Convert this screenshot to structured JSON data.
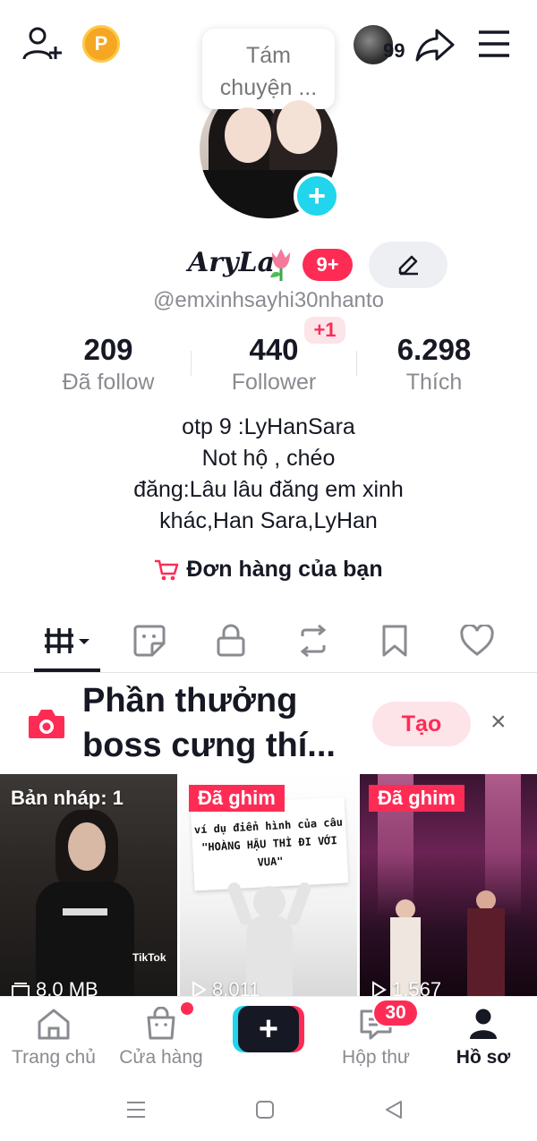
{
  "header": {
    "bubble_text": "Tám chuyện ...",
    "story_count": "99"
  },
  "profile": {
    "name": "AryLa",
    "level_badge": "9+",
    "handle": "@emxinhsayhi30nhanto"
  },
  "stats": [
    {
      "value": "209",
      "label": "Đã follow"
    },
    {
      "value": "440",
      "label": "Follower",
      "badge": "+1"
    },
    {
      "value": "6.298",
      "label": "Thích"
    }
  ],
  "bio": [
    "otp 9 :LyHanSara",
    "Not hộ , chéo",
    "đăng:Lâu lâu đăng em xinh",
    "khác,Han Sara,LyHan"
  ],
  "orders_label": "Đơn hàng của bạn",
  "reward": {
    "title": "Phần thưởng boss cưng thí...",
    "create_label": "Tạo",
    "close_label": "×"
  },
  "videos": [
    {
      "tag": "Bản nháp: 1",
      "meta": "8,0 MB",
      "watermark": "TikTok"
    },
    {
      "tag": "Đã ghim",
      "meta": "8.011",
      "sign_line1": "ví dụ điển hình của câu",
      "sign_line2": "\"HOÀNG HẬU THÌ ĐI VỚI VUA\""
    },
    {
      "tag": "Đã ghim",
      "meta": "1.567"
    }
  ],
  "bottom_nav": {
    "home": "Trang chủ",
    "shop": "Cửa hàng",
    "inbox": "Hộp thư",
    "inbox_badge": "30",
    "profile": "Hồ sơ"
  },
  "colors": {
    "accent": "#fe2c55",
    "cyan": "#20d5ec",
    "text": "#161823",
    "muted": "#8a8b91"
  }
}
